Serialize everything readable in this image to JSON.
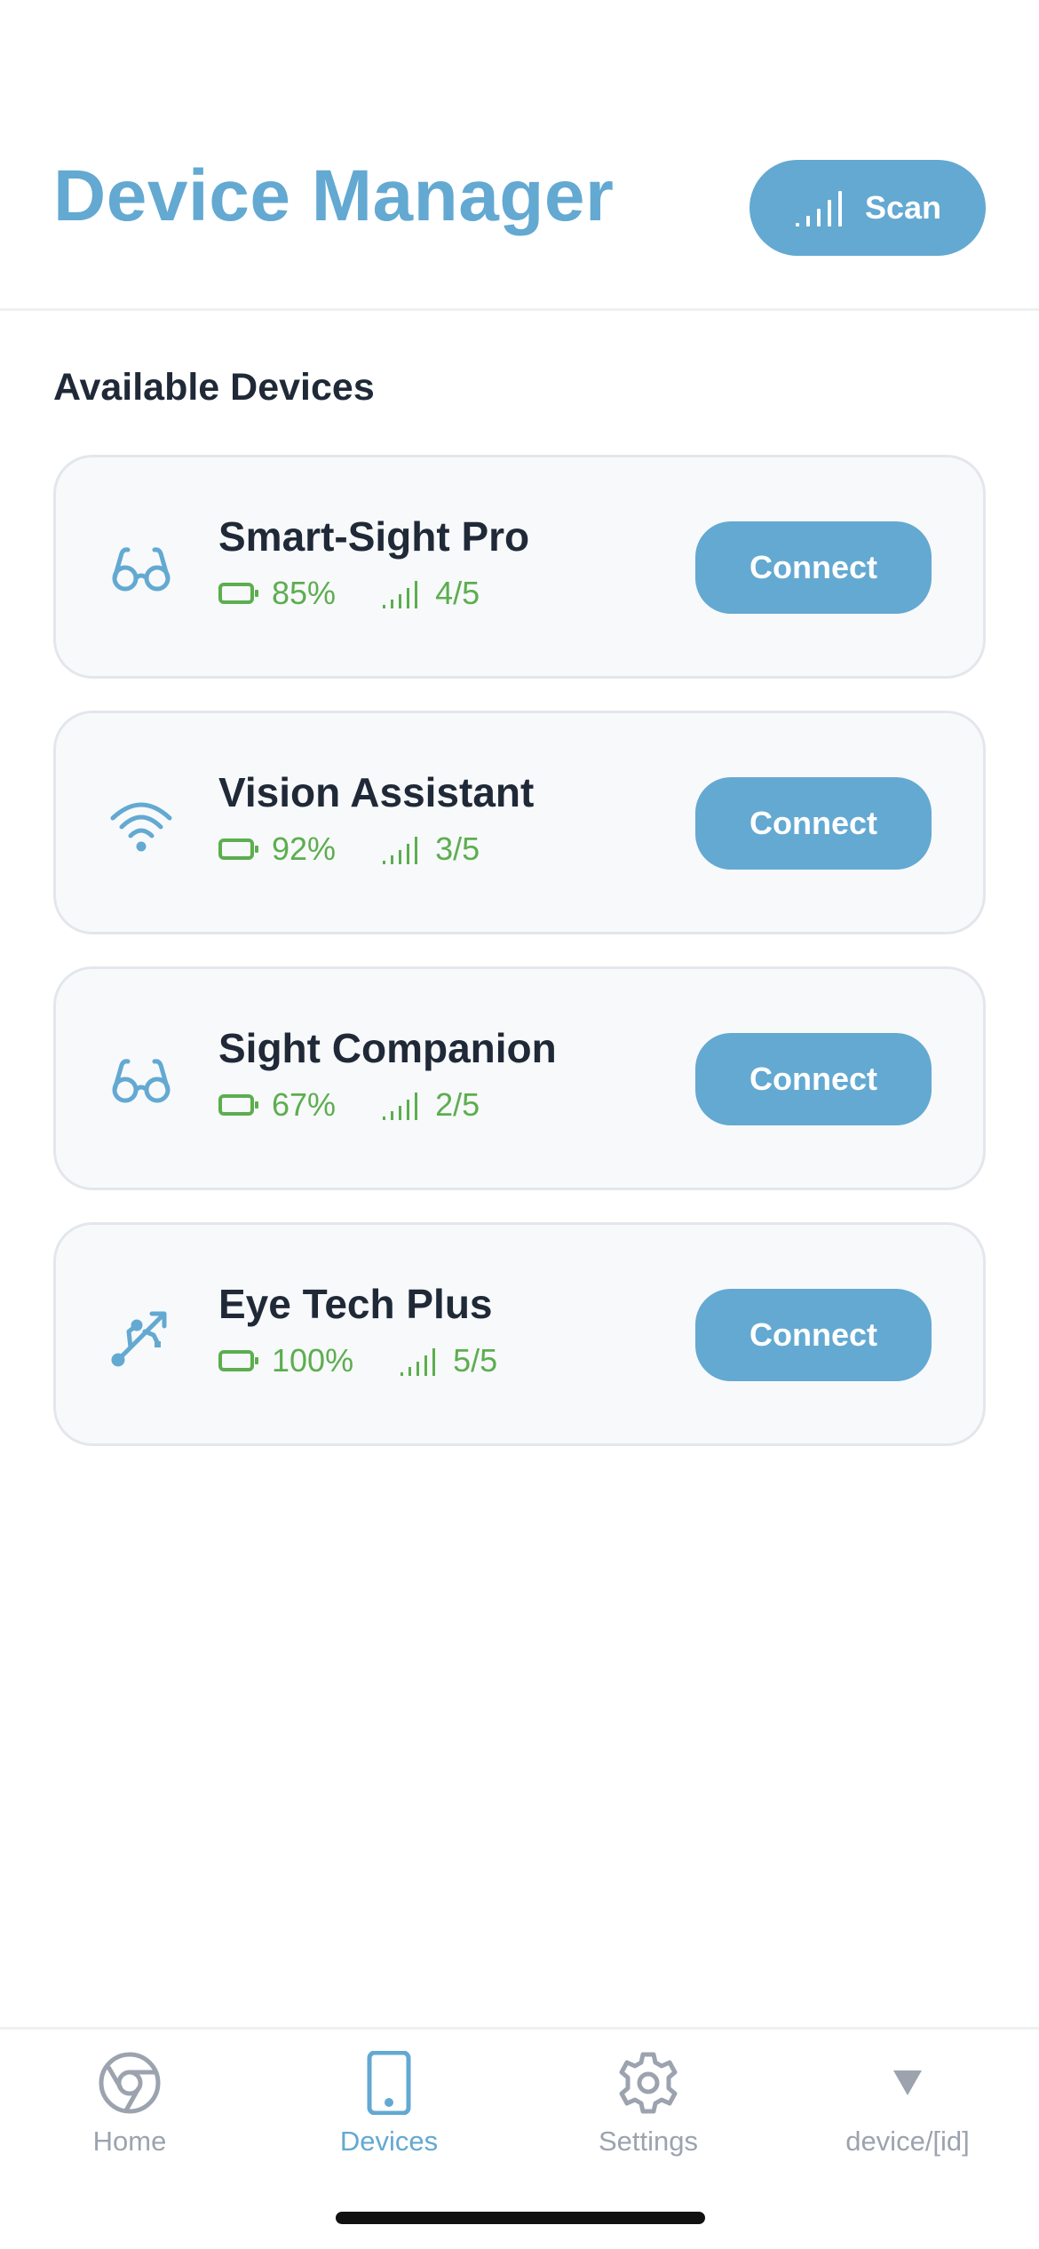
{
  "header": {
    "title": "Device Manager",
    "scan_label": "Scan"
  },
  "section_title": "Available Devices",
  "devices": [
    {
      "name": "Smart-Sight Pro",
      "icon": "glasses-icon",
      "battery": "85%",
      "signal": "4/5",
      "connect_label": "Connect"
    },
    {
      "name": "Vision Assistant",
      "icon": "wifi-icon",
      "battery": "92%",
      "signal": "3/5",
      "connect_label": "Connect"
    },
    {
      "name": "Sight Companion",
      "icon": "glasses-icon",
      "battery": "67%",
      "signal": "2/5",
      "connect_label": "Connect"
    },
    {
      "name": "Eye Tech Plus",
      "icon": "usb-icon",
      "battery": "100%",
      "signal": "5/5",
      "connect_label": "Connect"
    }
  ],
  "tabs": [
    {
      "label": "Home",
      "icon": "chrome-icon",
      "active": false
    },
    {
      "label": "Devices",
      "icon": "phone-icon",
      "active": true
    },
    {
      "label": "Settings",
      "icon": "gear-icon",
      "active": false
    },
    {
      "label": "device/[id]",
      "icon": "triangle-down-icon",
      "active": false
    }
  ],
  "colors": {
    "accent": "#63a9d2",
    "status_green": "#5cae4f",
    "text_dark": "#1f2937",
    "tab_inactive": "#9ca3af"
  }
}
